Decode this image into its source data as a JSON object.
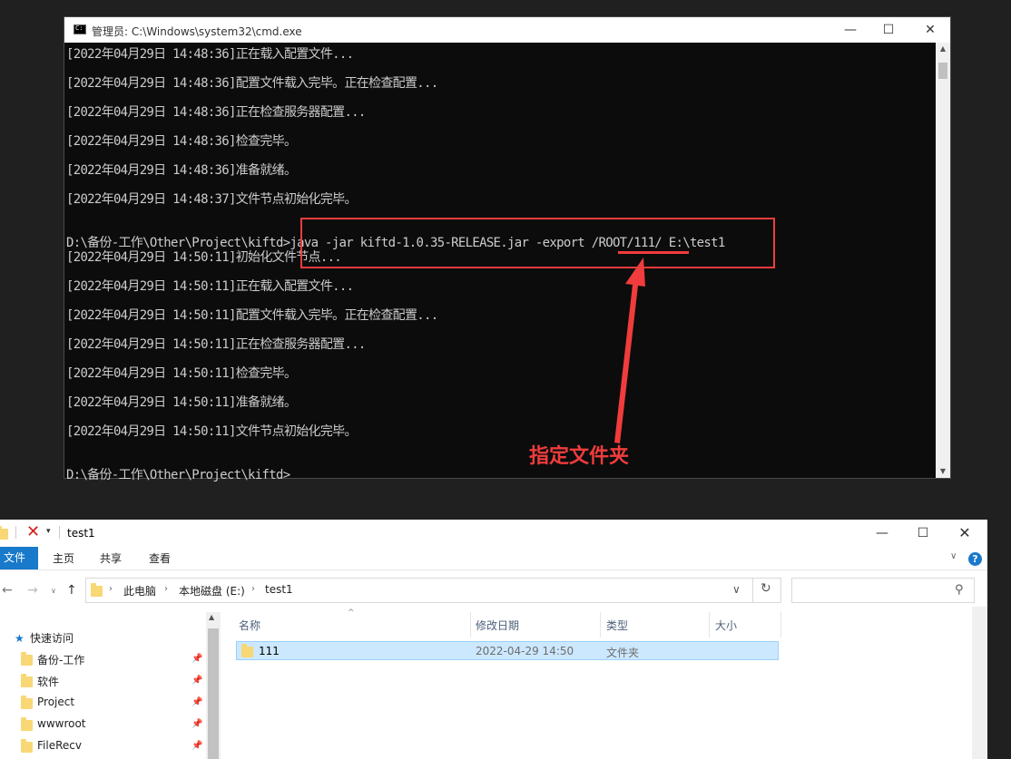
{
  "cmd": {
    "title": "管理员: C:\\Windows\\system32\\cmd.exe",
    "lines": [
      "[2022年04月29日 14:48:36]正在载入配置文件...",
      "[2022年04月29日 14:48:36]配置文件载入完毕。正在检查配置...",
      "[2022年04月29日 14:48:36]正在检查服务器配置...",
      "[2022年04月29日 14:48:36]检查完毕。",
      "[2022年04月29日 14:48:36]准备就绪。",
      "[2022年04月29日 14:48:37]文件节点初始化完毕。",
      "D:\\备份-工作\\Other\\Project\\kiftd>java -jar kiftd-1.0.35-RELEASE.jar -export /ROOT/111/ E:\\test1",
      "[2022年04月29日 14:50:11]初始化文件节点...",
      "[2022年04月29日 14:50:11]正在载入配置文件...",
      "[2022年04月29日 14:50:11]配置文件载入完毕。正在检查配置...",
      "[2022年04月29日 14:50:11]正在检查服务器配置...",
      "[2022年04月29日 14:50:11]检查完毕。",
      "[2022年04月29日 14:50:11]准备就绪。",
      "[2022年04月29日 14:50:11]文件节点初始化完毕。",
      "D:\\备份-工作\\Other\\Project\\kiftd>"
    ],
    "min_glyph": "—",
    "max_glyph": "☐",
    "close_glyph": "✕"
  },
  "annotation": {
    "text": "指定文件夹",
    "color": "#f03c3c"
  },
  "explorer": {
    "title": "test1",
    "tabs": [
      "文件",
      "主页",
      "共享",
      "查看"
    ],
    "breadcrumb": [
      "此电脑",
      "本地磁盘 (E:)",
      "test1"
    ],
    "quick_access_label": "快速访问",
    "nav_items": [
      "备份-工作",
      "软件",
      "Project",
      "wwwroot",
      "FileRecv"
    ],
    "columns": [
      "名称",
      "修改日期",
      "类型",
      "大小"
    ],
    "rows": [
      {
        "name": "111",
        "modified": "2022-04-29 14:50",
        "type": "文件夹",
        "size": ""
      }
    ],
    "min_glyph": "—",
    "max_glyph": "☐",
    "close_glyph": "✕",
    "help_glyph": "?"
  },
  "colors": {
    "accent": "#1979ca",
    "selection": "#cce8ff",
    "console_bg": "#0c0c0c",
    "console_fg": "#cccccc"
  }
}
